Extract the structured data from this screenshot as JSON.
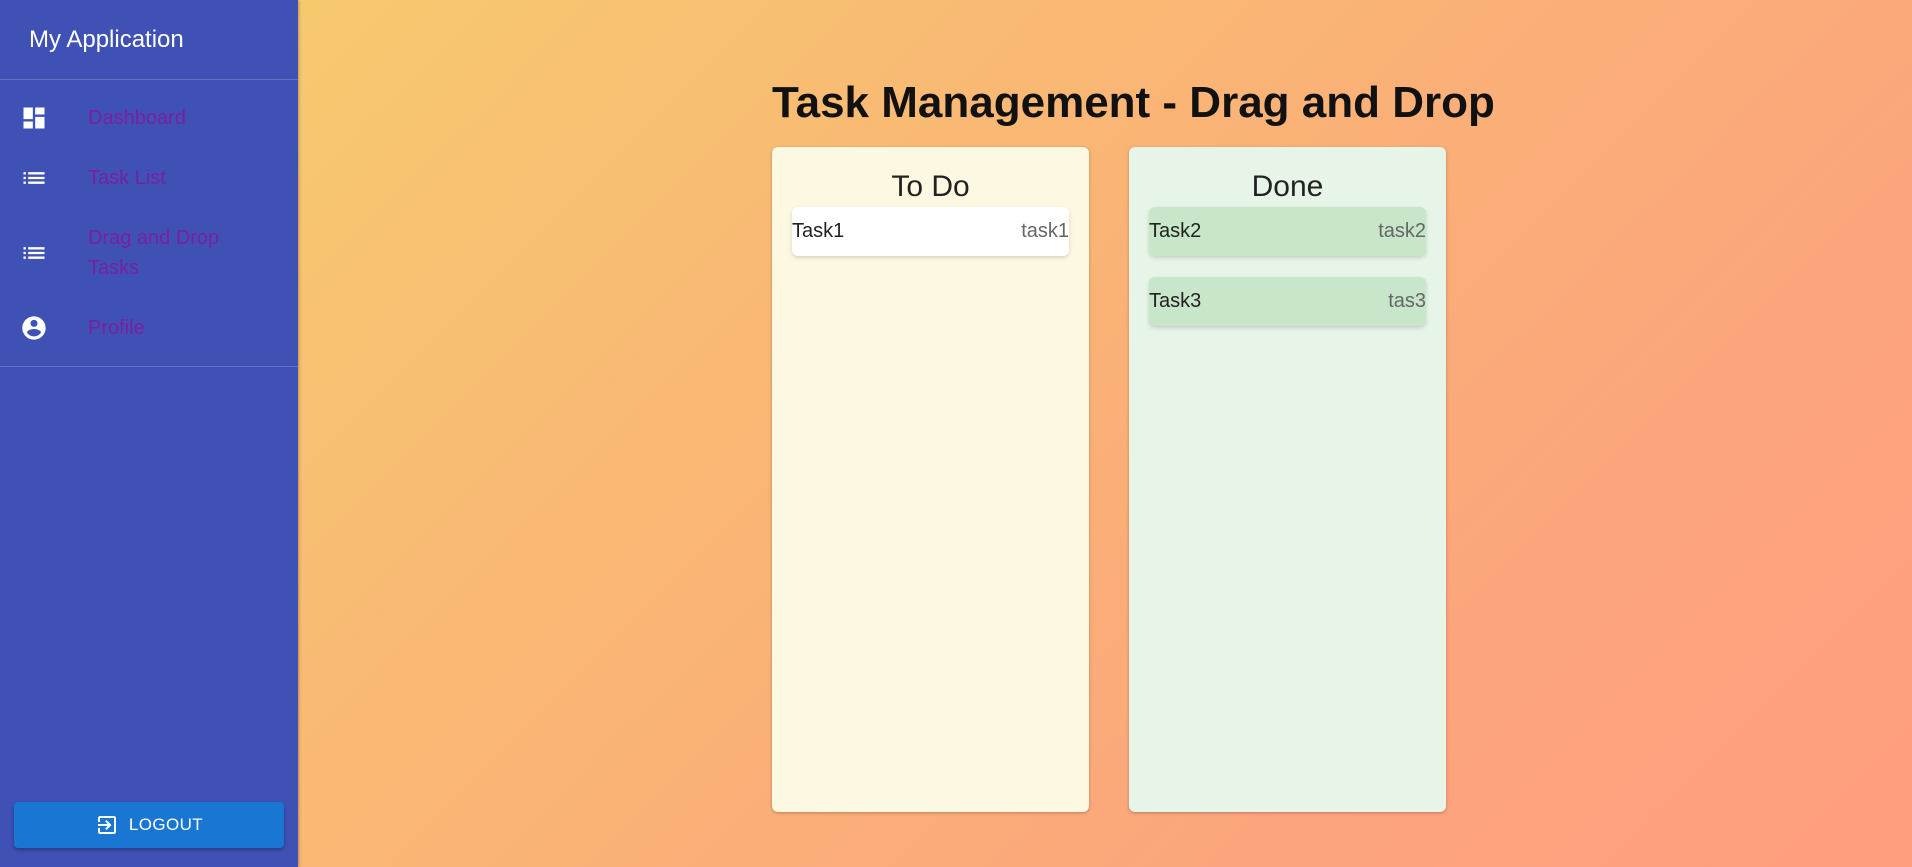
{
  "app": {
    "title": "My Application"
  },
  "sidebar": {
    "items": [
      {
        "label": "Dashboard",
        "icon": "dashboard-icon"
      },
      {
        "label": "Task List",
        "icon": "list-icon"
      },
      {
        "label": "Drag and Drop Tasks",
        "icon": "list-icon"
      },
      {
        "label": "Profile",
        "icon": "account-circle-icon"
      }
    ],
    "logout_label": "LOGOUT"
  },
  "main": {
    "title": "Task Management - Drag and Drop",
    "columns": [
      {
        "title": "To Do",
        "tasks": [
          {
            "title": "Task1",
            "description": "task1"
          }
        ]
      },
      {
        "title": "Done",
        "tasks": [
          {
            "title": "Task2",
            "description": "task2"
          },
          {
            "title": "Task3",
            "description": "tas3"
          }
        ]
      }
    ]
  },
  "colors": {
    "sidebar_bg": "#3f51b5",
    "nav_label": "#7b1fa2",
    "logout_bg": "#1976d2",
    "todo_column_bg": "#fdf8e1",
    "done_column_bg": "#e7f5e8",
    "done_card_bg": "#c8e6c9"
  }
}
